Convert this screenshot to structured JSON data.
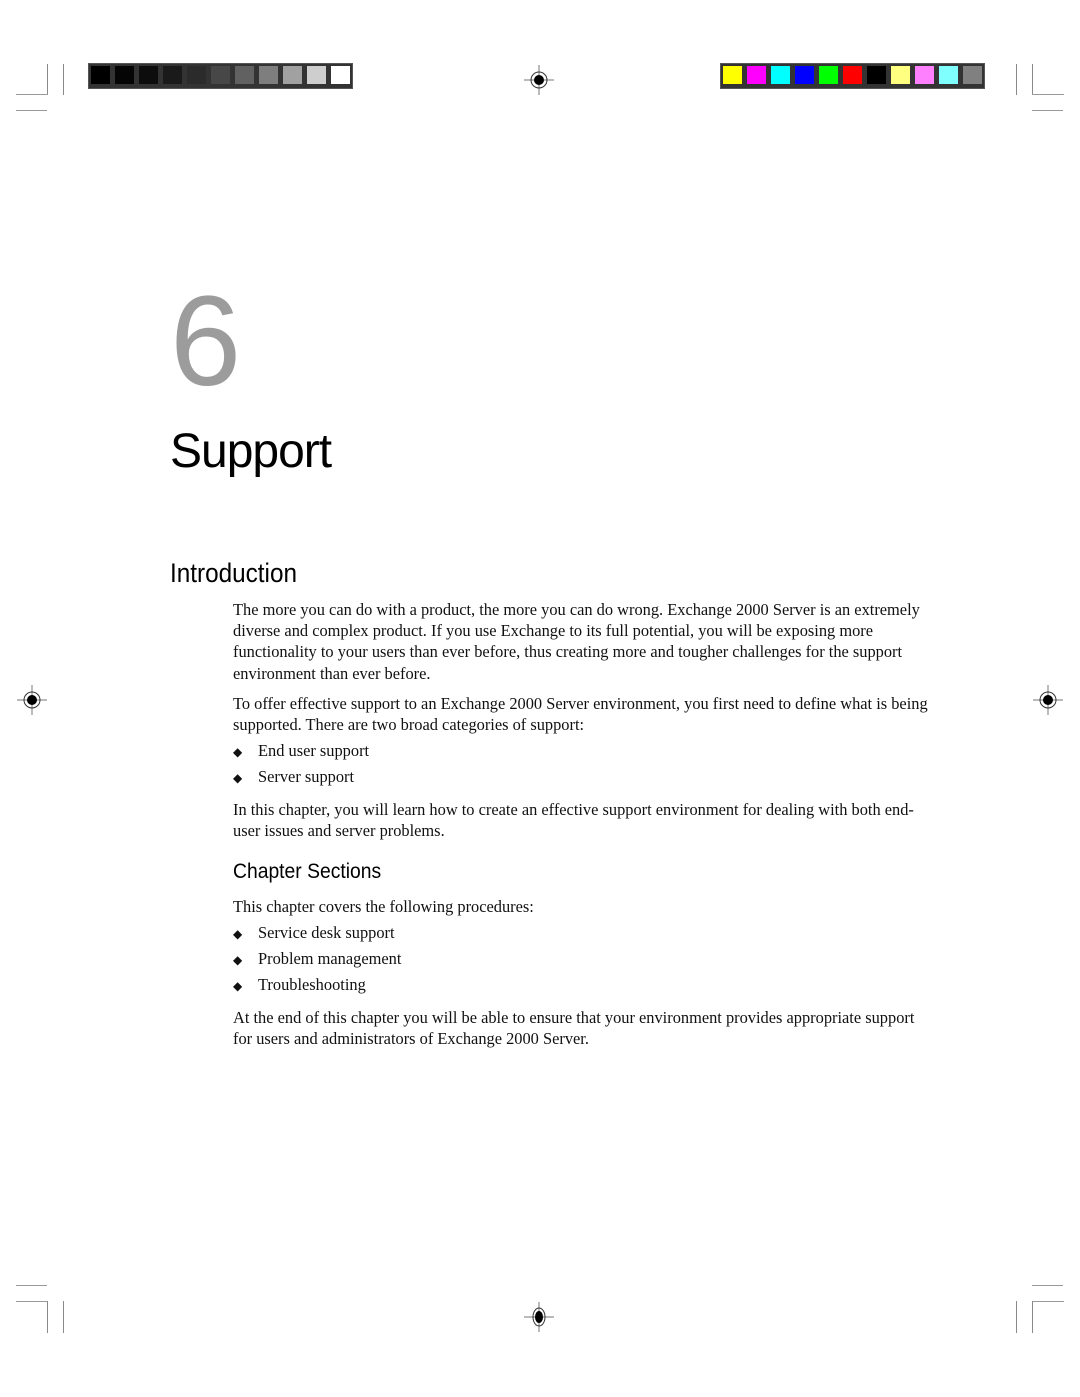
{
  "printer_marks": {
    "grayscale_bar": [
      "#000000",
      "#050505",
      "#0d0d0d",
      "#1a1a1a",
      "#2b2b2b",
      "#474747",
      "#616161",
      "#7e7e7e",
      "#a1a1a1",
      "#cecece",
      "#ffffff"
    ],
    "color_bar": [
      "#ffff00",
      "#ff00ff",
      "#00ffff",
      "#0000ff",
      "#00ff00",
      "#ff0000",
      "#000000",
      "#ffff80",
      "#ff80ff",
      "#80ffff",
      "#808080"
    ],
    "registration_icon": "registration-target-icon"
  },
  "chapter": {
    "number": "6",
    "title": "Support"
  },
  "introduction": {
    "heading": "Introduction",
    "paragraph1": "The more you can do with a product, the more you can do wrong. Exchange 2000 Server is an extremely diverse and complex product. If you use Exchange to its full potential, you will be exposing more functionality to your users than ever before, thus creating more and tougher challenges for the support environment than ever before.",
    "paragraph2": "To offer effective support to an Exchange 2000 Server environment, you first need to define what is being supported. There are two broad categories of support:",
    "bullets": [
      "End user support",
      "Server support"
    ],
    "paragraph3": "In this chapter, you will learn how to create an effective support environment for dealing with both end-user issues and server problems.",
    "bullet_glyph": "◆"
  },
  "chapter_sections": {
    "heading": "Chapter Sections",
    "lead": "This chapter covers the following procedures:",
    "bullets": [
      "Service desk support",
      "Problem management",
      "Troubleshooting"
    ],
    "closing": "At the end of this chapter you will be able to ensure that your environment provides appropriate support for users and administrators of Exchange 2000 Server."
  }
}
